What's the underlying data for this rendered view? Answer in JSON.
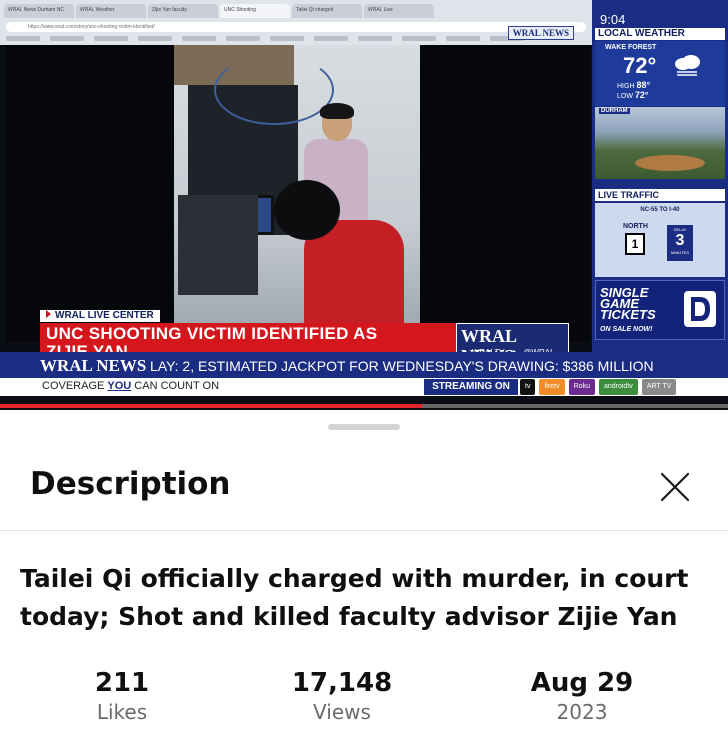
{
  "browser": {
    "tabs": [
      "WRAL News Durham NC",
      "WRAL Weather",
      "Zijie Yan faculty",
      "UNC Shooting",
      "Tailei Qi charged",
      "WRAL Live"
    ],
    "address": "https://www.wral.com/story/unc-shooting-victim-identified/"
  },
  "video": {
    "mini_logo": "WRAL NEWS",
    "lower_third": {
      "label": "WRAL LIVE CENTER",
      "headline_line1": "UNC SHOOTING VICTIM IDENTIFIED AS",
      "headline_line2": "ZIJIE YAN",
      "logo": "WRAL NEWS",
      "social_fb": "WRALTV",
      "social_tw": "@WRAL"
    },
    "side": {
      "time": "9:04",
      "weather_title": "LOCAL WEATHER",
      "city": "WAKE FOREST",
      "temp": "72°",
      "high_label": "HIGH",
      "high": "88°",
      "low_label": "LOW",
      "low": "72°",
      "cam_label": "DURHAM",
      "traffic_title": "LIVE TRAFFIC",
      "route": "NC-55 TO I-40",
      "direction": "NORTH",
      "shield": "1",
      "delay_label": "DELAY",
      "delay_value": "3",
      "delay_unit": "MINUTES",
      "tickets_text": "SINGLE GAME TICKETS",
      "tickets_sub": "ON SALE NOW!"
    },
    "ticker": {
      "logo": "WRAL NEWS",
      "text": "LAY: 2, ESTIMATED JACKPOT FOR WEDNESDAY'S DRAWING: $386 MILLION",
      "strap_pre": "COVERAGE ",
      "strap_you": "YOU",
      "strap_post": " CAN COUNT ON",
      "streaming": "STREAMING ON",
      "services": [
        "tv",
        "firetv",
        "Roku",
        "androidtv",
        "ART TV"
      ]
    },
    "progress": 0.58,
    "colors": {
      "brand_blue": "#1b2d82",
      "headline_red": "#d3171d",
      "progress_red": "#e3262b"
    }
  },
  "sheet": {
    "title": "Description",
    "description": "Tailei Qi officially charged with murder, in court today; Shot and killed faculty advisor Zijie Yan",
    "stats": [
      {
        "value": "211",
        "label": "Likes"
      },
      {
        "value": "17,148",
        "label": "Views"
      },
      {
        "value": "Aug 29",
        "label": "2023"
      }
    ]
  }
}
